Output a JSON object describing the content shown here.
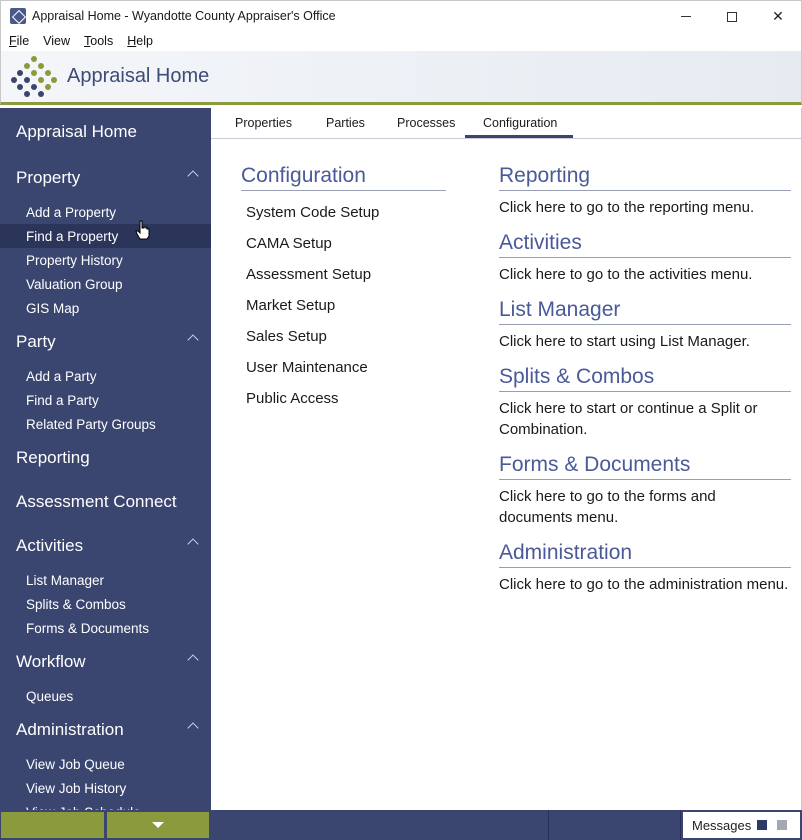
{
  "window": {
    "title": "Appraisal Home - Wyandotte County Appraiser's Office",
    "close_glyph": "✕"
  },
  "menubar": {
    "items": [
      {
        "label": "File",
        "mnemonic": "F",
        "rest": "ile"
      },
      {
        "label": "View",
        "mnemonic": "",
        "rest": "View"
      },
      {
        "label": "Tools",
        "mnemonic": "T",
        "rest": "ools"
      },
      {
        "label": "Help",
        "mnemonic": "H",
        "rest": "elp"
      }
    ]
  },
  "header": {
    "title": "Appraisal Home",
    "accent_color": "#8a9a3c",
    "brand_color": "#3a4570"
  },
  "sidebar": {
    "home": "Appraisal Home",
    "property": {
      "title": "Property",
      "items": [
        "Add a Property",
        "Find a Property",
        "Property History",
        "Valuation Group",
        "GIS Map"
      ]
    },
    "party": {
      "title": "Party",
      "items": [
        "Add a Party",
        "Find a Party",
        "Related Party Groups"
      ]
    },
    "reporting": "Reporting",
    "assessment_connect": "Assessment Connect",
    "activities": {
      "title": "Activities",
      "items": [
        "List Manager",
        "Splits & Combos",
        "Forms & Documents"
      ]
    },
    "workflow": {
      "title": "Workflow",
      "items": [
        "Queues"
      ]
    },
    "administration": {
      "title": "Administration",
      "items": [
        "View Job Queue",
        "View Job History",
        "View Job Schedule"
      ]
    }
  },
  "tabs": [
    {
      "label": "Properties"
    },
    {
      "label": "Parties"
    },
    {
      "label": "Processes"
    },
    {
      "label": "Configuration",
      "selected": true
    }
  ],
  "configuration": {
    "heading": "Configuration",
    "links": [
      "System Code Setup",
      "CAMA Setup",
      "Assessment Setup",
      "Market Setup",
      "Sales Setup",
      "User Maintenance",
      "Public Access"
    ]
  },
  "right_sections": [
    {
      "heading": "Reporting",
      "text": "Click here to go to the reporting menu."
    },
    {
      "heading": "Activities",
      "text": "Click here to go to the activities menu."
    },
    {
      "heading": "List Manager",
      "text": "Click here to start using List Manager."
    },
    {
      "heading": "Splits & Combos",
      "text": "Click here to start or continue a Split or Combination."
    },
    {
      "heading": "Forms & Documents",
      "text": "Click here to go to the forms and documents menu."
    },
    {
      "heading": "Administration",
      "text": "Click here to go to the administration menu."
    }
  ],
  "statusbar": {
    "messages_label": "Messages"
  }
}
